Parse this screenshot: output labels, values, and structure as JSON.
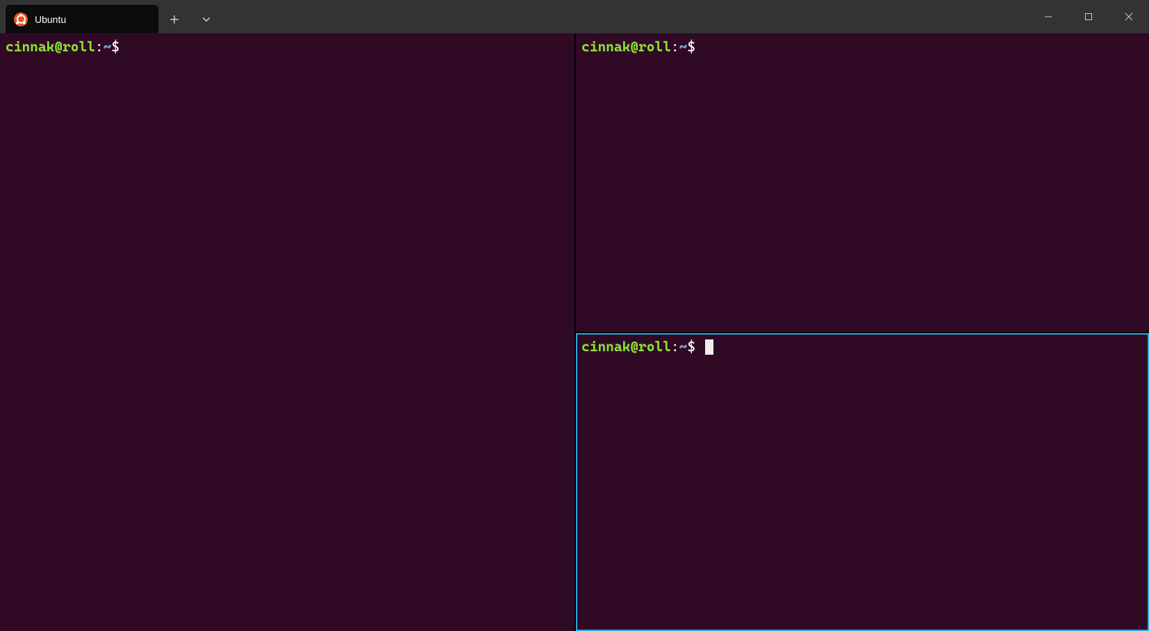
{
  "titlebar": {
    "tabs": [
      {
        "title": "Ubuntu"
      }
    ]
  },
  "panes": {
    "left": {
      "user_host": "cinnak@roll",
      "colon": ":",
      "path": "~",
      "prompt": "$",
      "focused": false,
      "has_cursor": false
    },
    "top_right": {
      "user_host": "cinnak@roll",
      "colon": ":",
      "path": "~",
      "prompt": "$",
      "focused": false,
      "has_cursor": false
    },
    "bottom_right": {
      "user_host": "cinnak@roll",
      "colon": ":",
      "path": "~",
      "prompt": "$",
      "focused": true,
      "has_cursor": true
    }
  },
  "colors": {
    "terminal_bg": "#300a24",
    "titlebar_bg": "#333333",
    "tab_bg": "#0c0c0c",
    "prompt_user": "#8ae234",
    "prompt_path": "#729fcf",
    "focus_ring": "#2aa9e0"
  }
}
